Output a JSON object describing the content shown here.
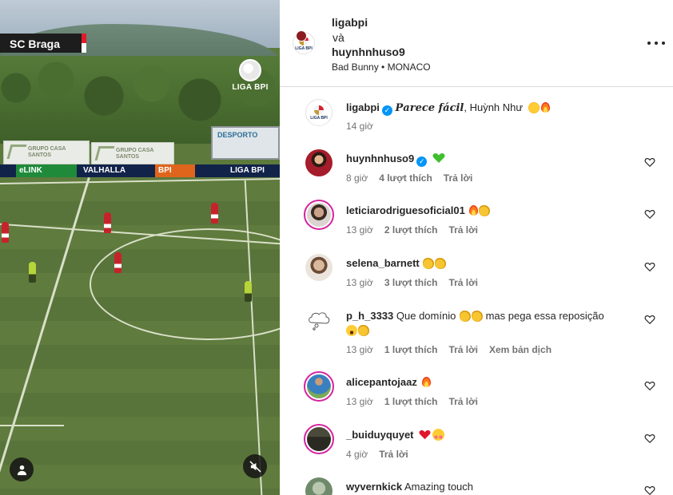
{
  "video": {
    "team_label": "SC Braga",
    "league_logo_text": "LIGA BPI",
    "billboards": [
      "GRUPO CASA SANTOS",
      "GRUPO CASA SANTOS"
    ],
    "screen_text": "DESPORTO",
    "ads": [
      "eLINK",
      "VALHALLA",
      "BPI",
      "LIGA BPI"
    ]
  },
  "header": {
    "user1": "ligabpi",
    "connector": "và",
    "user2": "huynhnhuso9",
    "music": "Bad Bunny • MONACO",
    "avatar_text": "LIGA BPI"
  },
  "caption": {
    "username": "ligabpi",
    "text_styled": "𝑷𝒂𝒓𝒆𝒄𝒆 𝒇á𝒄𝒊𝒍",
    "text_rest": ", Huỳnh Như",
    "time": "14 giờ"
  },
  "comments": [
    {
      "username": "huynhnhuso9",
      "verified": true,
      "text": "",
      "time": "8 giờ",
      "likes": "4 lượt thích",
      "reply": "Trả lời",
      "translate": ""
    },
    {
      "username": "leticiarodriguesoficial01",
      "verified": false,
      "text": "",
      "time": "13 giờ",
      "likes": "2 lượt thích",
      "reply": "Trả lời",
      "translate": ""
    },
    {
      "username": "selena_barnett",
      "verified": false,
      "text": "",
      "time": "13 giờ",
      "likes": "3 lượt thích",
      "reply": "Trả lời",
      "translate": ""
    },
    {
      "username": "p_h_3333",
      "verified": false,
      "text": "Que domínio",
      "text2": "mas pega essa reposição",
      "time": "13 giờ",
      "likes": "1 lượt thích",
      "reply": "Trả lời",
      "translate": "Xem bản dịch"
    },
    {
      "username": "alicepantojaaz",
      "verified": false,
      "text": "",
      "time": "13 giờ",
      "likes": "1 lượt thích",
      "reply": "Trả lời",
      "translate": ""
    },
    {
      "username": "_buiduyquyet",
      "verified": false,
      "text": "",
      "time": "4 giờ",
      "likes": "",
      "reply": "Trả lời",
      "translate": ""
    },
    {
      "username": "wyvernkick",
      "verified": false,
      "text": "Amazing touch",
      "time": "",
      "likes": "",
      "reply": "",
      "translate": ""
    }
  ],
  "icons": {
    "more": "more-horizontal-icon",
    "heart": "heart-outline-icon",
    "verified": "verified-badge-icon",
    "mute": "speaker-muted-icon",
    "user": "user-tag-icon"
  },
  "colors": {
    "accent_blue": "#0095f6",
    "story_ring": "#d6249f",
    "meta_gray": "#737373",
    "braga_red": "#e21b2a"
  }
}
